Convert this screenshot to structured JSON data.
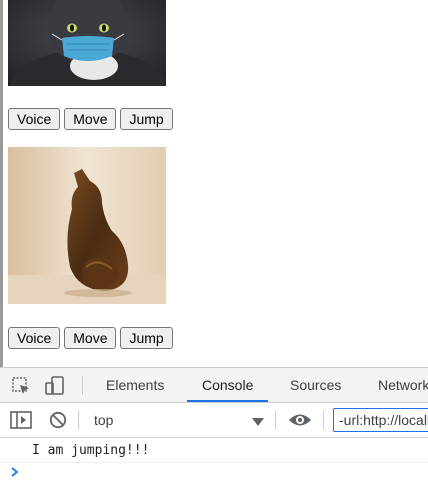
{
  "images": [
    {
      "description_icon": "cat-with-face-mask-photo"
    },
    {
      "description_icon": "wooden-cat-figurine-photo"
    }
  ],
  "cards": [
    {
      "buttons": {
        "voice": "Voice",
        "move": "Move",
        "jump": "Jump"
      }
    },
    {
      "buttons": {
        "voice": "Voice",
        "move": "Move",
        "jump": "Jump"
      }
    }
  ],
  "devtools": {
    "tabs": [
      "Elements",
      "Console",
      "Sources",
      "Network"
    ],
    "active_tab": "Console",
    "toolbar": {
      "context": "top",
      "filter_value": "-url:http://localhost"
    },
    "console": {
      "messages": [
        "I am jumping!!!"
      ],
      "prompt_symbol": "›"
    }
  },
  "colors": {
    "accent": "#1a73e8",
    "devtools_bg": "#f1f3f4",
    "icon_gray": "#5f6368"
  }
}
